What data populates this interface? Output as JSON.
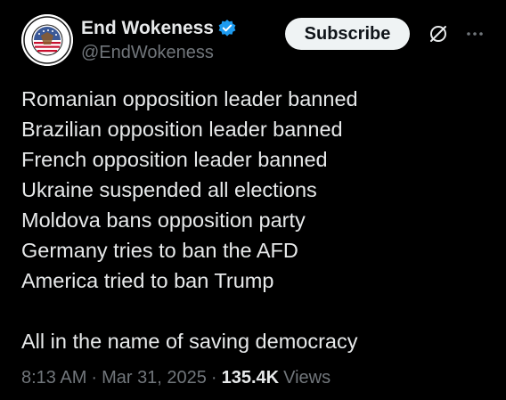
{
  "author": {
    "display_name": "End Wokeness",
    "handle": "@EndWokeness",
    "avatar_icon": "end-wokeness-logo",
    "verified_icon": "verified-badge-icon",
    "verified_color": "#1d9bf0",
    "avatar_ring_text_top": "SUPPORT",
    "avatar_ring_text_bottom": "BORDER PATROL"
  },
  "toolbar": {
    "subscribe_label": "Subscribe",
    "grok_icon": "grok-icon",
    "more_icon": "more-icon"
  },
  "tweet": {
    "lines": [
      "Romanian opposition leader banned",
      "Brazilian opposition leader banned",
      "French opposition leader banned",
      "Ukraine suspended all elections",
      "Moldova bans opposition party",
      "Germany tries to ban the AFD",
      "America tried to ban Trump"
    ],
    "closing": "All in the name of saving democracy"
  },
  "meta": {
    "time": "8:13 AM",
    "separator": "·",
    "date": "Mar 31, 2025",
    "views_count": "135.4K",
    "views_label": "Views"
  },
  "colors": {
    "background": "#000000",
    "primary_text": "#e7e9ea",
    "secondary_text": "#71767b",
    "button_bg": "#eff3f4",
    "button_text": "#0f1419"
  }
}
